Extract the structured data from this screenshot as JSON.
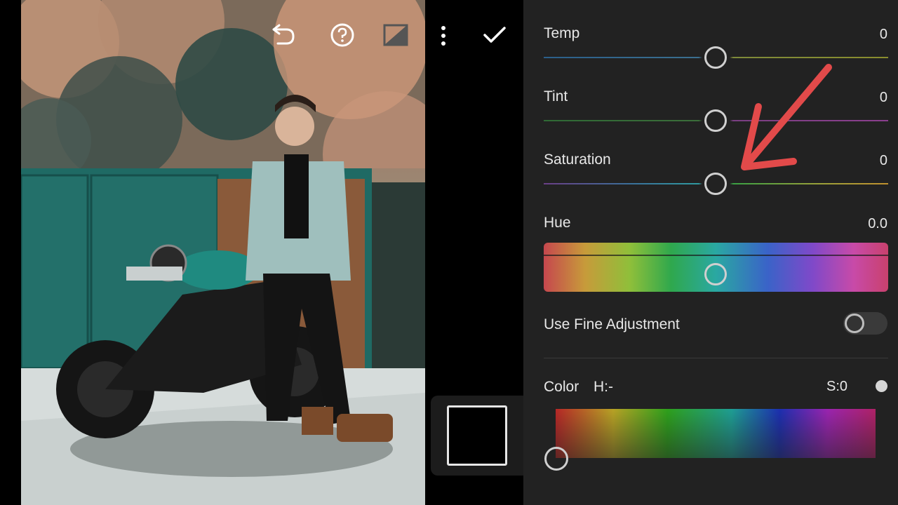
{
  "photo": {
    "alt_subject": "man on motorcycle"
  },
  "toolbar": {
    "undo_icon": "undo-icon",
    "help_icon": "help-icon",
    "compare_icon": "compare-icon",
    "more_icon": "more-vertical-icon",
    "done_icon": "checkmark-icon"
  },
  "panel": {
    "temp": {
      "label": "Temp",
      "value": "0",
      "level": 0.5
    },
    "tint": {
      "label": "Tint",
      "value": "0",
      "level": 0.5
    },
    "saturation": {
      "label": "Saturation",
      "value": "0",
      "level": 0.5
    },
    "hue": {
      "label": "Hue",
      "value": "0.0",
      "level": 0.5
    },
    "fine_adjustment": {
      "label": "Use Fine Adjustment",
      "enabled": false
    },
    "color": {
      "label": "Color",
      "h_text": "H:-",
      "s_text": "S:0"
    }
  },
  "colors": {
    "panel_bg": "#222222",
    "annotation_arrow": "#e24a4a"
  }
}
